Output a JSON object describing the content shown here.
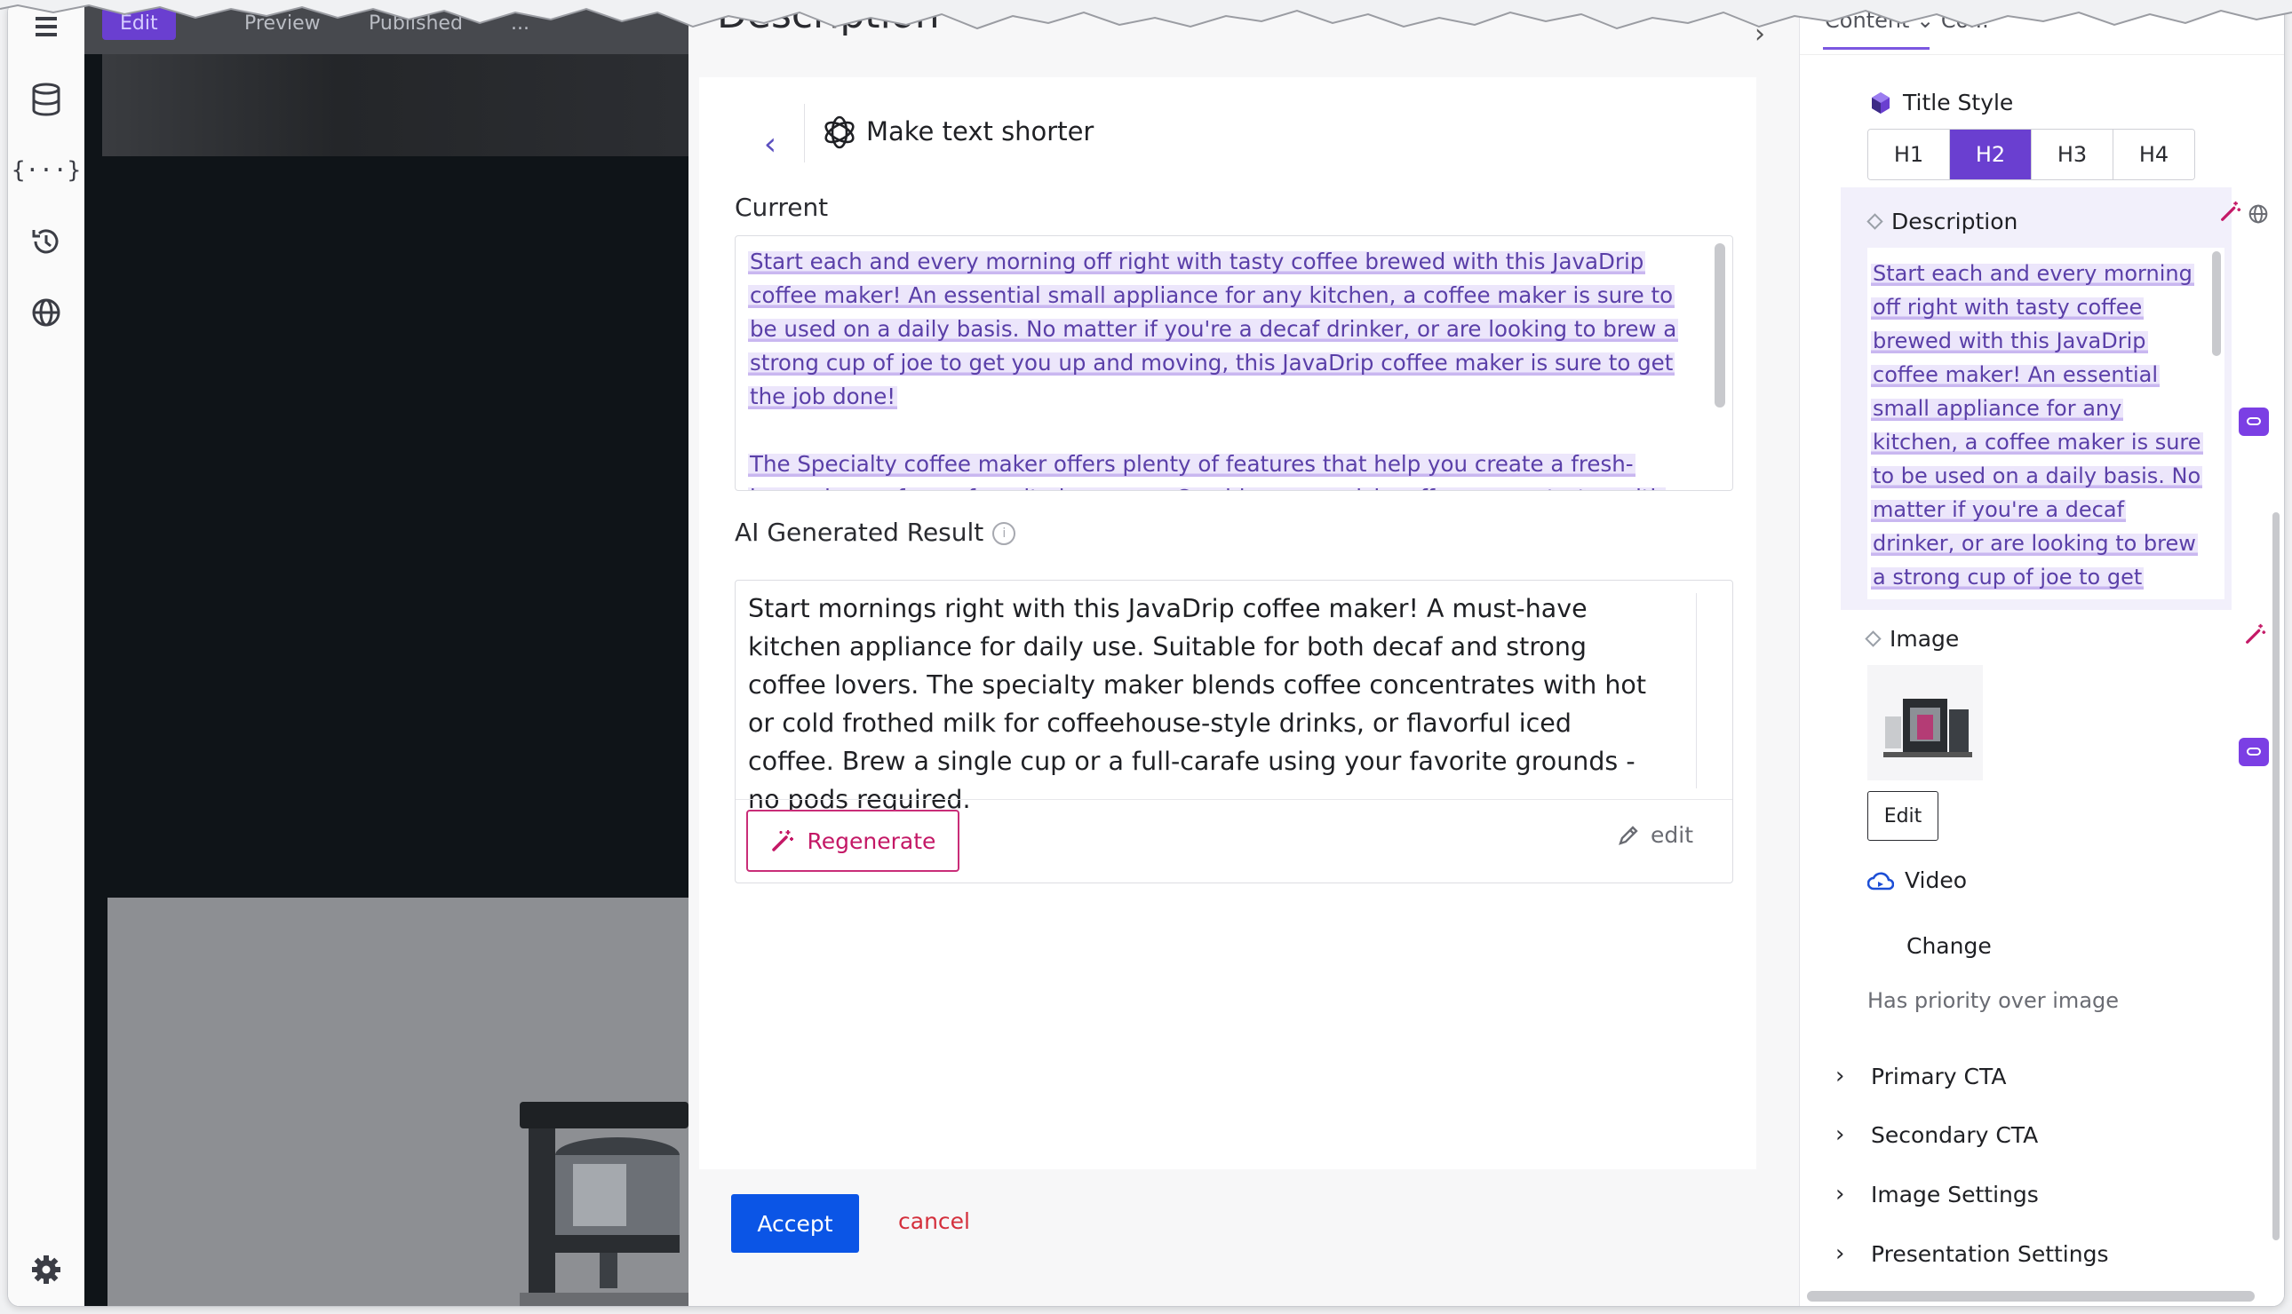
{
  "preview": {
    "tabs": [
      "Edit",
      "Preview",
      "Published",
      "..."
    ]
  },
  "modal": {
    "heading": "Description",
    "command_title": "Make text shorter",
    "current_label": "Current",
    "current_text_p1": "Start each and every morning off right with tasty coffee brewed with this JavaDrip coffee maker! An essential small appliance for any kitchen, a coffee maker is sure to be used on a daily basis. No matter if you're a decaf drinker, or are looking to brew a strong cup of joe to get you up and moving, this JavaDrip coffee maker is sure to get the job done!",
    "current_text_p2": "The Specialty coffee maker offers plenty of features that help you create a fresh-brewed cup of your favorite beverage. Combine super-rich coffee concentrates with hot or cold",
    "result_label": "AI Generated Result",
    "result_text": "Start mornings right with this JavaDrip coffee maker! A must-have kitchen appliance for daily use. Suitable for both decaf and strong coffee lovers. The specialty maker blends coffee concentrates with hot or cold frothed milk for coffeehouse-style drinks, or flavorful iced coffee. Brew a single cup or a full-carafe using your favorite grounds - no pods required.",
    "regenerate_label": "Regenerate",
    "edit_label": "edit",
    "accept_label": "Accept",
    "cancel_label": "cancel"
  },
  "panel": {
    "tabs_text": "Content ⌄   Co...",
    "title_style": {
      "label": "Title Style",
      "options": [
        "H1",
        "H2",
        "H3",
        "H4"
      ],
      "selected": "H2"
    },
    "description": {
      "label": "Description",
      "text": "Start each and every morning off right with tasty coffee brewed with this JavaDrip coffee maker! An essential small appliance for any kitchen, a coffee maker is sure to be used on a daily basis. No matter if you're a decaf drinker, or are looking to brew a strong cup of joe to get"
    },
    "image": {
      "label": "Image",
      "edit_label": "Edit"
    },
    "video": {
      "label": "Video",
      "change_label": "Change",
      "hint": "Has priority over image"
    },
    "sections": [
      "Primary CTA",
      "Secondary CTA",
      "Image Settings",
      "Presentation Settings"
    ]
  },
  "colors": {
    "accent_purple": "#6a3fd0",
    "accept_blue": "#0b55e6",
    "regenerate_pink": "#c41866",
    "cancel_red": "#d42f3c",
    "highlight_text": "#5a3fa8"
  },
  "icons": [
    "menu-icon",
    "database-icon",
    "braces-icon",
    "history-icon",
    "globe-icon",
    "settings-gear-icon",
    "back-chevron-icon",
    "openai-logo-icon",
    "info-icon",
    "magic-wand-icon",
    "pencil-icon",
    "cube-icon",
    "cloud-video-icon",
    "link-pill-icon",
    "chevron-right-icon"
  ]
}
